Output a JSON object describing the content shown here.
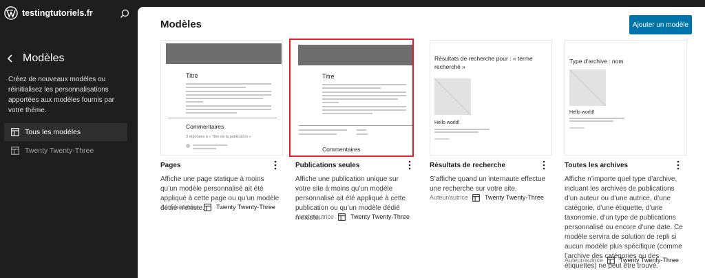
{
  "sidebar": {
    "site_name": "testingtutoriels.fr",
    "title": "Modèles",
    "description": "Créez de nouveaux modèles ou réinitialisez les personnalisations apportées aux modèles fournis par votre thème.",
    "nav": [
      {
        "label": "Tous les modèles",
        "active": true
      },
      {
        "label": "Twenty Twenty-Three",
        "active": false
      }
    ]
  },
  "main": {
    "title": "Modèles",
    "add_button": "Ajouter un modèle"
  },
  "preview": {
    "post_title": "Titre",
    "comments": "Commentaires",
    "replies": "3 réponses à « Titre de la publication »",
    "search_results": "Résultats de recherche pour : « terme recherché »",
    "archive_type": "Type d’archive : nom",
    "hello": "Hello world!"
  },
  "templates": [
    {
      "title": "Pages",
      "description": "Affiche une page statique à moins qu’un modèle personnalisé ait été appliqué à cette page ou qu’un modèle dédié n’existe.",
      "author_label": "Auteur/autrice",
      "theme": "Twenty Twenty-Three"
    },
    {
      "title": "Publications seules",
      "description": "Affiche une publication unique sur votre site à moins qu’un modèle personnalisé ait été appliqué à cette publication ou qu’un modèle dédié n’existe.",
      "author_label": "Auteur/autrice",
      "theme": "Twenty Twenty-Three"
    },
    {
      "title": "Résultats de recherche",
      "description": "S’affiche quand un internaute effectue une recherche sur votre site.",
      "author_label": "Auteur/autrice",
      "theme": "Twenty Twenty-Three"
    },
    {
      "title": "Toutes les archives",
      "description": "Affiche n’importe quel type d’archive, incluant les archives de publications d’un auteur ou d’une autrice, d’une catégorie, d’une étiquette, d’une taxonomie, d’un type de publications personnalisé ou encore d’une date. Ce modèle servira de solution de repli si aucun modèle plus spécifique (comme l’archive des catégories ou des étiquettes) ne peut être trouvé.",
      "author_label": "Auteur/autrice",
      "theme": "Twenty Twenty-Three"
    }
  ],
  "colors": {
    "accent": "#0073aa",
    "highlight": "#e0202a",
    "sidebar_bg": "#1e1e1e"
  }
}
